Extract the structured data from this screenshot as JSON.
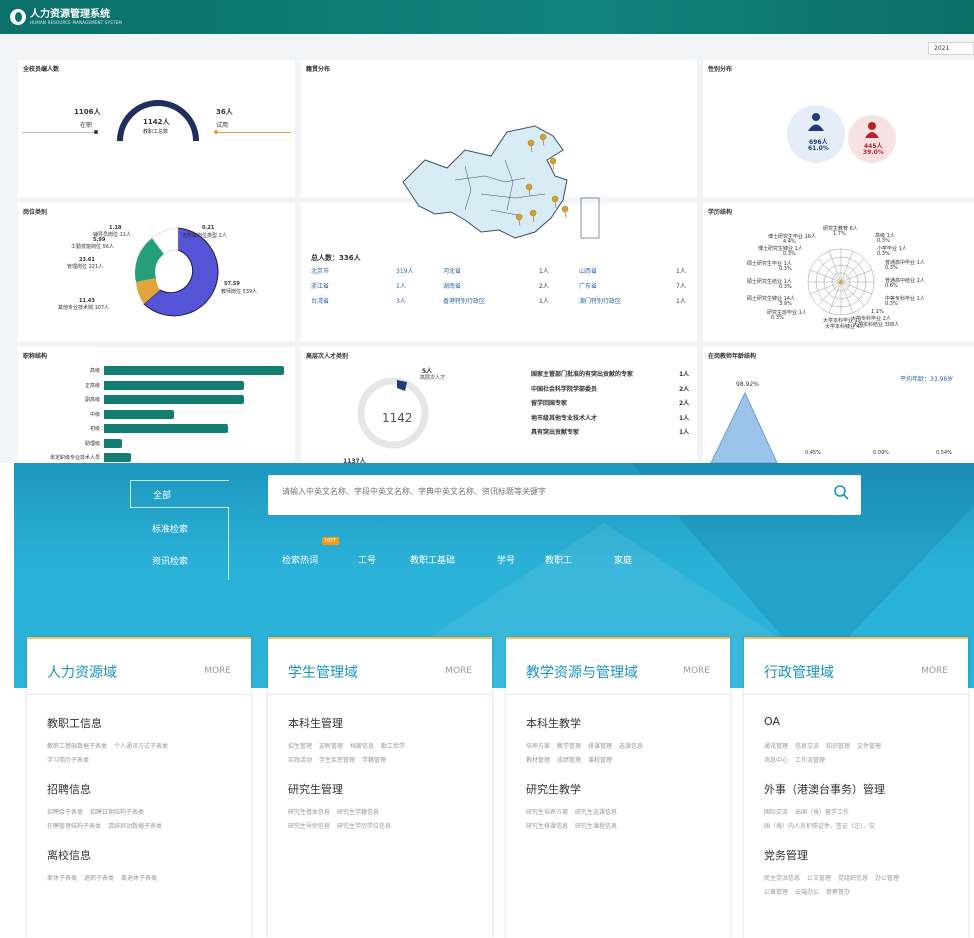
{
  "header": {
    "title": "人力资源管理系统",
    "subtitle": "HUMAN RESOURCE MANAGEMENT SYSTEM"
  },
  "year_select": {
    "value": "2021"
  },
  "staff": {
    "title": "全校员编人数",
    "in_post_count": "1106人",
    "in_post_label": "在职",
    "total": "1142人",
    "total_label": "教职工总数",
    "trial_count": "36人",
    "trial_label": "试用"
  },
  "region": {
    "title": "籍贯分布",
    "total_label": "总人数：336人",
    "rows": [
      [
        "北京市",
        "319人",
        "河北省",
        "1人",
        "山西省",
        "1人"
      ],
      [
        "浙江省",
        "1人",
        "湖南省",
        "2人",
        "广东省",
        "7人"
      ],
      [
        "台湾省",
        "3人",
        "香港特别行政区",
        "1人",
        "澳门特别行政区",
        "1人"
      ]
    ]
  },
  "gender": {
    "title": "性别分布",
    "male_count": "696人",
    "male_pct": "61.0%",
    "female_count": "445人",
    "female_pct": "39.0%"
  },
  "post": {
    "title": "岗位类别",
    "labels": [
      {
        "v": "1.18",
        "t": "辅导员岗位 11人"
      },
      {
        "v": "5.99",
        "t": "工勤技能岗位 56人"
      },
      {
        "v": "23.61",
        "t": "管理岗位 221人"
      },
      {
        "v": "0.21",
        "t": "无所属岗位类型 2人"
      },
      {
        "v": "57.59",
        "t": "教师岗位 539人"
      },
      {
        "v": "11.43",
        "t": "其他专业技术岗 107人"
      }
    ]
  },
  "education": {
    "title": "学历结构",
    "labels": [
      "研究生教育 6人",
      "1.7%",
      "博士研究生毕业 16人",
      "4.4%",
      "博士研究生肄业 1人",
      "0.3%",
      "高级 1人",
      "0.3%",
      "小学毕业 1人",
      "0.3%",
      "硕士研究生毕业 1人",
      "0.3%",
      "普通高中毕业 1人",
      "0.3%",
      "硕士研究生结业 1人",
      "0.3%",
      "普通高中结业 2人",
      "0.6%",
      "硕士研究生肄业 14人",
      "3.9%",
      "中等专科毕业 1人",
      "0.3%",
      "研究生班毕业 1人",
      "0.3%",
      "大学本科毕业 1人",
      "大学本科肄业 4人",
      "1.1%",
      "大学专科毕业 2人",
      "大学本科结业 308人",
      "85.6%"
    ]
  },
  "title_struct": {
    "title": "职称结构",
    "items": [
      {
        "label": "高级",
        "value": 100
      },
      {
        "label": "正高级",
        "value": 78
      },
      {
        "label": "副高级",
        "value": 78
      },
      {
        "label": "中级",
        "value": 39
      },
      {
        "label": "初级",
        "value": 69
      },
      {
        "label": "助理级",
        "value": 10
      },
      {
        "label": "未定职级专业技术人员",
        "value": 15
      }
    ]
  },
  "talent": {
    "title": "高层次人才类别",
    "marker": "5人",
    "marker_label": "高层次人才",
    "ring_value": "1142",
    "bottom_count": "1137人",
    "list": [
      [
        "国家主管部门批准的有突出贡献的专家",
        "1人"
      ],
      [
        "中国社会科学院学部委员",
        "2人"
      ],
      [
        "留学回国专家",
        "2人"
      ],
      [
        "地市级其他专业技术人才",
        "1人"
      ],
      [
        "具有突出贡献专家",
        "1人"
      ]
    ]
  },
  "age": {
    "title": "在岗教师年龄结构",
    "avg": "平均年龄：33.98岁",
    "peak": "98.92%",
    "ticks": [
      "0.45%",
      "0.09%",
      "0.54%"
    ]
  },
  "portal": {
    "nav": {
      "all": "全部",
      "standard": "标准检索",
      "news": "资讯检索"
    },
    "search_placeholder": "请输入中英文名称、字段中英文名称、字典中英文名称、资讯标题等关键字",
    "hot_badge": "HOT",
    "hot": [
      "检索热词",
      "工号",
      "教职工基础",
      "学号",
      "教职工",
      "家庭"
    ],
    "more": "MORE",
    "cards": [
      {
        "title": "人力资源域",
        "sections": [
          {
            "name": "教职工信息",
            "links": [
              "教职工基础数据子表类",
              "个人通讯方式子表类",
              "学习简历子表类"
            ]
          },
          {
            "name": "招聘信息",
            "links": [
              "招聘会子表类",
              "招聘日期结构子表类",
              "在聘管理结构子表类",
              "请辞异动数据子表类"
            ]
          },
          {
            "name": "离校信息",
            "links": [
              "离休子表类",
              "退职子表类",
              "离退休子表类"
            ]
          }
        ]
      },
      {
        "title": "学生管理域",
        "sections": [
          {
            "name": "本科生管理",
            "links": [
              "招生管理",
              "迎新管理",
              "档案信息",
              "勤工俭学",
              "实践活动",
              "学生奖惩管理",
              "学籍管理"
            ]
          },
          {
            "name": "研究生管理",
            "links": [
              "研究生基本信息",
              "研究生学籍信息",
              "研究生导师信息",
              "研究生学历学位信息"
            ]
          }
        ]
      },
      {
        "title": "教学资源与管理域",
        "sections": [
          {
            "name": "本科生教学",
            "links": [
              "培养方案",
              "教学管理",
              "排课管理",
              "选课信息",
              "教材管理",
              "成绩管理",
              "课程管理"
            ]
          },
          {
            "name": "研究生教学",
            "links": [
              "研究生培养方案",
              "研究生选课信息",
              "研究生排课信息",
              "研究生课程信息"
            ]
          }
        ]
      },
      {
        "title": "行政管理域",
        "sections": [
          {
            "name": "OA",
            "links": [
              "通讯管理",
              "信息交流",
              "知识管理",
              "文件管理",
              "消息中心",
              "工作流管理"
            ]
          },
          {
            "name": "外事（港澳台事务）管理",
            "links": [
              "国际交流",
              "出国（境）留学工作",
              "国（境）内人员护照证件、签证（注）、交"
            ]
          },
          {
            "name": "党务管理",
            "links": [
              "民主党派信息",
              "公文管理",
              "党组织信息",
              "办公管理",
              "公章管理",
              "云端办公",
              "督察督办"
            ]
          }
        ]
      }
    ]
  }
}
